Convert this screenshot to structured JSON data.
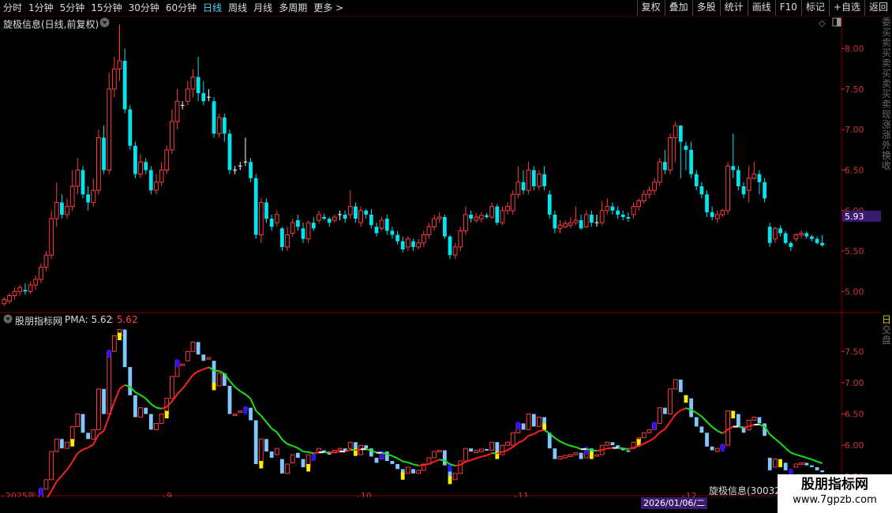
{
  "toolbar": {
    "tabs": [
      "分时",
      "1分钟",
      "5分钟",
      "15分钟",
      "30分钟",
      "60分钟",
      "日线",
      "周线",
      "月线",
      "多周期",
      "更多 >"
    ],
    "active_tab": "日线",
    "right_buttons": [
      "复权",
      "叠加",
      "多股",
      "统计",
      "画线",
      "F10",
      "标记",
      "+自选",
      "返回"
    ]
  },
  "main_panel": {
    "title": "旋极信息(日线,前复权)",
    "price_label": "5.93",
    "y_ticks": [
      "8.00",
      "7.50",
      "7.00",
      "6.50",
      "6.00",
      "5.50",
      "5.00"
    ]
  },
  "sub_panel": {
    "indicator_name": "股朋指标网",
    "pma_label": "PMA: 5.62",
    "pma_value": ": 5.62",
    "y_ticks": [
      "7.50",
      "7.00",
      "6.50",
      "6.00",
      "5.50"
    ]
  },
  "x_axis": {
    "labels": [
      "2025年",
      "9",
      "10",
      "11",
      "12",
      "2"
    ]
  },
  "crosshair": {
    "date_label": "2026/01/06/二"
  },
  "stock_popup": {
    "name": "旋极信息(30032"
  },
  "watermark": {
    "title": "股朋指标网",
    "url": "www.7gpzb.com"
  },
  "right_strip": {
    "chars": [
      "委",
      "买",
      "卖",
      "买",
      "卖",
      "买",
      "卖",
      "买",
      "卖",
      "现",
      "涨",
      "涨",
      "外",
      "换",
      "收"
    ],
    "chars2": [
      "日",
      "交",
      "盘"
    ]
  },
  "colors": {
    "up": "#ff3c3c",
    "down": "#00e5ee",
    "ma_up": "#ff2020",
    "ma_down": "#19e019",
    "ma_flat": "#ffffff",
    "bar_blue": "#7fc8ff",
    "bar_yellow": "#ffee00",
    "bar_violet": "#2a14ff",
    "grid": "#7a0000",
    "price_label_bg": "#3a1b6e",
    "crosshair_label_bg": "#3a1b6e"
  },
  "chart_data": {
    "type": "candlestick",
    "title": "旋极信息(日线,前复权)",
    "ylim": [
      4.75,
      8.25
    ],
    "candles": [
      [
        4.85,
        4.9,
        4.82,
        4.93
      ],
      [
        4.88,
        4.95,
        4.85,
        4.98
      ],
      [
        4.95,
        5.0,
        4.9,
        5.05
      ],
      [
        5.0,
        5.05,
        4.95,
        5.08
      ],
      [
        5.02,
        5.0,
        4.96,
        5.1
      ],
      [
        5.0,
        5.08,
        4.97,
        5.12
      ],
      [
        5.08,
        5.15,
        5.02,
        5.2
      ],
      [
        5.15,
        5.3,
        5.1,
        5.35
      ],
      [
        5.3,
        5.45,
        5.25,
        5.5
      ],
      [
        5.45,
        5.9,
        5.4,
        6.0
      ],
      [
        5.9,
        6.1,
        5.8,
        6.35
      ],
      [
        6.1,
        5.95,
        5.9,
        6.2
      ],
      [
        5.95,
        6.05,
        5.9,
        6.15
      ],
      [
        6.05,
        6.3,
        6.0,
        6.5
      ],
      [
        6.3,
        6.5,
        6.2,
        6.65
      ],
      [
        6.5,
        6.2,
        6.15,
        6.55
      ],
      [
        6.2,
        6.1,
        6.0,
        6.3
      ],
      [
        6.1,
        6.25,
        6.05,
        6.4
      ],
      [
        6.25,
        6.9,
        6.2,
        7.0
      ],
      [
        6.9,
        6.5,
        6.45,
        7.05
      ],
      [
        6.5,
        7.5,
        6.45,
        7.7
      ],
      [
        7.5,
        7.75,
        7.4,
        7.9
      ],
      [
        7.75,
        7.85,
        7.6,
        8.3
      ],
      [
        7.85,
        7.25,
        7.2,
        8.0
      ],
      [
        7.25,
        6.8,
        6.75,
        7.3
      ],
      [
        6.8,
        6.45,
        6.4,
        6.85
      ],
      [
        6.45,
        6.6,
        6.4,
        6.7
      ],
      [
        6.6,
        6.5,
        6.45,
        6.65
      ],
      [
        6.5,
        6.25,
        6.2,
        6.55
      ],
      [
        6.25,
        6.35,
        6.2,
        6.45
      ],
      [
        6.35,
        6.5,
        6.3,
        6.6
      ],
      [
        6.5,
        6.75,
        6.45,
        6.8
      ],
      [
        6.75,
        7.1,
        6.7,
        7.25
      ],
      [
        7.1,
        7.35,
        7.0,
        7.5
      ],
      [
        7.3,
        7.3,
        7.25,
        7.35
      ],
      [
        7.35,
        7.5,
        7.3,
        7.6
      ],
      [
        7.5,
        7.65,
        7.4,
        7.75
      ],
      [
        7.65,
        7.45,
        7.35,
        7.9
      ],
      [
        7.45,
        7.35,
        7.3,
        7.6
      ],
      [
        7.4,
        7.4,
        7.35,
        7.5
      ],
      [
        7.35,
        6.95,
        6.9,
        7.4
      ],
      [
        6.95,
        7.15,
        6.9,
        7.2
      ],
      [
        7.15,
        6.95,
        6.85,
        7.2
      ],
      [
        6.95,
        6.5,
        6.45,
        7.0
      ],
      [
        6.5,
        6.5,
        6.45,
        6.55
      ],
      [
        6.55,
        6.55,
        6.5,
        6.6
      ],
      [
        6.6,
        6.6,
        6.55,
        6.9
      ],
      [
        6.6,
        6.4,
        6.35,
        6.65
      ],
      [
        6.4,
        5.7,
        5.65,
        6.45
      ],
      [
        5.7,
        6.1,
        5.6,
        6.15
      ],
      [
        6.1,
        5.9,
        5.85,
        6.15
      ],
      [
        5.9,
        5.8,
        5.75,
        5.95
      ],
      [
        5.85,
        5.95,
        5.8,
        6.0
      ],
      [
        5.78,
        5.55,
        5.5,
        5.8
      ],
      [
        5.55,
        5.7,
        5.5,
        5.8
      ],
      [
        5.72,
        5.85,
        5.68,
        5.9
      ],
      [
        5.88,
        5.8,
        5.75,
        5.95
      ],
      [
        5.78,
        5.65,
        5.6,
        5.85
      ],
      [
        5.65,
        5.85,
        5.6,
        5.88
      ],
      [
        5.85,
        5.78,
        5.75,
        5.92
      ],
      [
        5.88,
        5.95,
        5.84,
        6.0
      ],
      [
        5.92,
        5.9,
        5.88,
        5.96
      ],
      [
        5.9,
        5.85,
        5.8,
        5.92
      ],
      [
        5.88,
        5.92,
        5.85,
        5.95
      ],
      [
        5.95,
        5.95,
        5.88,
        6.0
      ],
      [
        5.95,
        5.9,
        5.85,
        6.0
      ],
      [
        5.95,
        6.05,
        5.9,
        6.25
      ],
      [
        6.05,
        5.9,
        5.85,
        6.1
      ],
      [
        5.85,
        6.0,
        5.8,
        6.05
      ],
      [
        6.0,
        5.95,
        5.9,
        6.02
      ],
      [
        5.95,
        5.82,
        5.78,
        6.02
      ],
      [
        5.8,
        5.72,
        5.68,
        5.85
      ],
      [
        5.78,
        5.88,
        5.75,
        5.92
      ],
      [
        5.9,
        5.75,
        5.7,
        5.95
      ],
      [
        5.75,
        5.7,
        5.65,
        5.8
      ],
      [
        5.7,
        5.62,
        5.58,
        5.75
      ],
      [
        5.62,
        5.52,
        5.48,
        5.68
      ],
      [
        5.55,
        5.65,
        5.5,
        5.68
      ],
      [
        5.62,
        5.55,
        5.5,
        5.65
      ],
      [
        5.55,
        5.6,
        5.52,
        5.65
      ],
      [
        5.6,
        5.7,
        5.55,
        5.75
      ],
      [
        5.7,
        5.8,
        5.65,
        5.85
      ],
      [
        5.8,
        5.9,
        5.75,
        5.95
      ],
      [
        5.9,
        5.92,
        5.85,
        5.98
      ],
      [
        5.92,
        5.68,
        5.65,
        5.95
      ],
      [
        5.68,
        5.45,
        5.4,
        5.7
      ],
      [
        5.45,
        5.55,
        5.4,
        5.6
      ],
      [
        5.55,
        5.75,
        5.5,
        5.8
      ],
      [
        5.75,
        5.95,
        5.7,
        6.05
      ],
      [
        5.95,
        5.9,
        5.85,
        6.0
      ],
      [
        5.88,
        5.92,
        5.85,
        5.97
      ],
      [
        5.9,
        5.94,
        5.85,
        5.98
      ],
      [
        5.94,
        5.92,
        5.9,
        5.97
      ],
      [
        5.92,
        6.05,
        5.9,
        6.1
      ],
      [
        6.05,
        5.85,
        5.82,
        6.08
      ],
      [
        5.85,
        6.0,
        5.82,
        6.05
      ],
      [
        6.0,
        6.05,
        5.95,
        6.1
      ],
      [
        6.0,
        6.2,
        5.95,
        6.25
      ],
      [
        6.2,
        6.35,
        6.15,
        6.55
      ],
      [
        6.35,
        6.25,
        6.2,
        6.5
      ],
      [
        6.25,
        6.5,
        6.2,
        6.6
      ],
      [
        6.5,
        6.3,
        6.25,
        6.55
      ],
      [
        6.3,
        6.45,
        6.25,
        6.5
      ],
      [
        6.45,
        6.3,
        6.25,
        6.55
      ],
      [
        6.2,
        5.95,
        5.9,
        6.25
      ],
      [
        5.95,
        5.78,
        5.72,
        6.0
      ],
      [
        5.78,
        5.82,
        5.72,
        5.88
      ],
      [
        5.8,
        5.84,
        5.78,
        5.88
      ],
      [
        5.82,
        5.85,
        5.78,
        5.92
      ],
      [
        5.85,
        5.88,
        5.82,
        6.05
      ],
      [
        5.88,
        5.78,
        5.76,
        5.95
      ],
      [
        5.8,
        5.95,
        5.78,
        6.0
      ],
      [
        5.95,
        5.85,
        5.8,
        6.0
      ],
      [
        5.85,
        5.85,
        5.8,
        5.95
      ],
      [
        5.85,
        6.0,
        5.82,
        6.12
      ],
      [
        6.0,
        6.05,
        5.95,
        6.15
      ],
      [
        6.05,
        6.0,
        5.95,
        6.1
      ],
      [
        6.0,
        5.95,
        5.9,
        6.05
      ],
      [
        5.95,
        5.92,
        5.88,
        6.0
      ],
      [
        5.92,
        5.9,
        5.86,
        5.98
      ],
      [
        5.95,
        6.05,
        5.9,
        6.1
      ],
      [
        6.05,
        6.12,
        6.0,
        6.15
      ],
      [
        6.12,
        6.2,
        6.08,
        6.25
      ],
      [
        6.2,
        6.25,
        6.15,
        6.3
      ],
      [
        6.25,
        6.35,
        6.2,
        6.4
      ],
      [
        6.35,
        6.6,
        6.3,
        6.65
      ],
      [
        6.6,
        6.5,
        6.45,
        6.75
      ],
      [
        6.5,
        6.9,
        6.45,
        6.95
      ],
      [
        6.9,
        7.05,
        6.6,
        7.1
      ],
      [
        7.05,
        6.85,
        6.4,
        7.05
      ],
      [
        6.8,
        6.75,
        6.5,
        6.85
      ],
      [
        6.75,
        6.45,
        6.4,
        6.85
      ],
      [
        6.45,
        6.3,
        6.25,
        6.5
      ],
      [
        6.3,
        6.2,
        6.15,
        6.35
      ],
      [
        6.2,
        5.98,
        5.92,
        6.25
      ],
      [
        5.98,
        5.92,
        5.88,
        6.05
      ],
      [
        5.9,
        5.95,
        5.85,
        6.0
      ],
      [
        5.95,
        6.0,
        5.92,
        6.02
      ],
      [
        6.0,
        6.55,
        5.95,
        6.6
      ],
      [
        6.55,
        6.5,
        6.4,
        6.95
      ],
      [
        6.5,
        6.3,
        6.25,
        6.55
      ],
      [
        6.3,
        6.2,
        6.15,
        6.35
      ],
      [
        6.25,
        6.4,
        6.1,
        6.55
      ],
      [
        6.4,
        6.45,
        6.38,
        6.6
      ],
      [
        6.45,
        6.35,
        6.2,
        6.5
      ],
      [
        6.35,
        6.15,
        6.1,
        6.4
      ],
      [
        5.8,
        5.6,
        5.55,
        5.85
      ],
      [
        5.65,
        5.78,
        5.6,
        5.8
      ],
      [
        5.78,
        5.72,
        5.68,
        5.82
      ],
      [
        5.72,
        5.6,
        5.58,
        5.75
      ],
      [
        5.6,
        5.55,
        5.5,
        5.62
      ],
      [
        5.65,
        5.7,
        5.62,
        5.72
      ],
      [
        5.7,
        5.72,
        5.66,
        5.76
      ],
      [
        5.72,
        5.68,
        5.65,
        5.74
      ],
      [
        5.68,
        5.65,
        5.62,
        5.7
      ],
      [
        5.65,
        5.6,
        5.58,
        5.68
      ],
      [
        5.6,
        5.57,
        5.55,
        5.7
      ]
    ],
    "series": [
      {
        "name": "PMA",
        "last": 5.62
      }
    ],
    "sub_ylim": [
      5.17,
      7.92
    ]
  }
}
